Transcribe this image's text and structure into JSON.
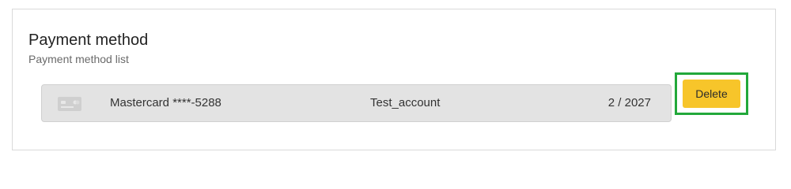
{
  "section": {
    "title": "Payment method",
    "subtitle": "Payment method list"
  },
  "payment_methods": [
    {
      "icon": "credit-card-icon",
      "name": "Mastercard ****-5288",
      "account": "Test_account",
      "expiry": "2 / 2027",
      "delete_label": "Delete"
    }
  ],
  "colors": {
    "delete_button": "#f7c52a",
    "highlight_border": "#22a83a",
    "row_background": "#e3e3e3"
  }
}
